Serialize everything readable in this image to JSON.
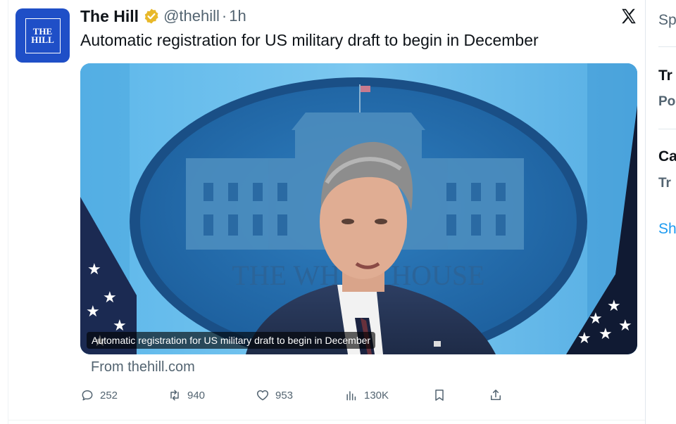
{
  "tweet": {
    "display_name": "The Hill",
    "handle": "@thehill",
    "separator": "·",
    "time": "1h",
    "text": "Automatic registration for US military draft to begin in December",
    "avatar_text_line1": "THE",
    "avatar_text_line2": "HILL",
    "verified_color": "#e8b829",
    "media": {
      "caption": "Automatic registration for US military draft to begin in December",
      "backdrop_text": "THE WHITE HOUSE"
    },
    "source": "From thehill.com",
    "actions": {
      "replies": "252",
      "reposts": "940",
      "likes": "953",
      "views": "130K"
    }
  },
  "platform": {
    "logo": "x-logo-icon"
  },
  "sidebar": {
    "item1": "Sp",
    "item2_title": "Tr",
    "item2_sub": "Po",
    "item3_title": "Ca",
    "item3_sub": "Tr",
    "show_more": "Sh"
  },
  "colors": {
    "accent": "#1d9bf0",
    "secondary_text": "#536471",
    "avatar_bg": "#1f4fc7"
  }
}
